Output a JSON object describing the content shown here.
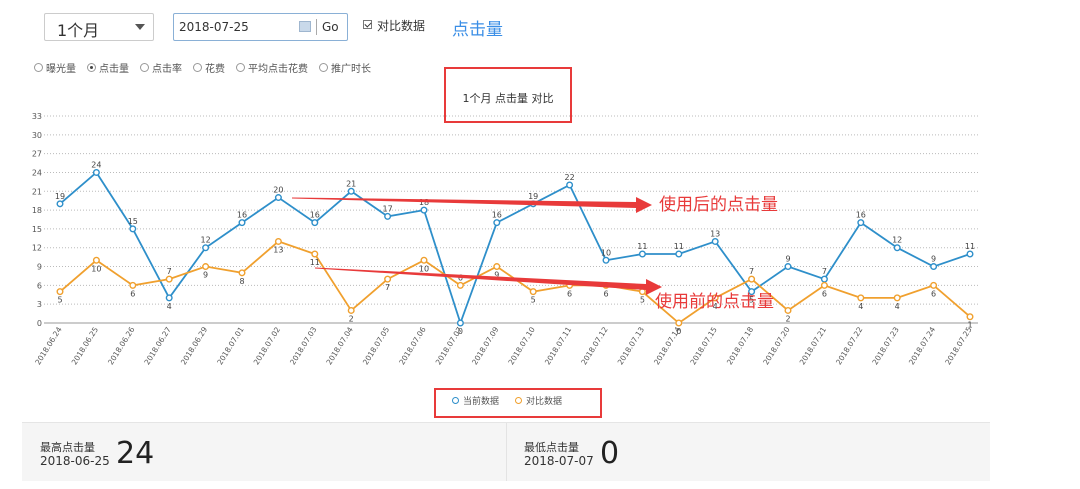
{
  "controls": {
    "period_value": "1个月",
    "date_value": "2018-07-25",
    "go_label": "Go",
    "compare_label": "对比数据",
    "compare_checked": true,
    "metric_title": "点击量"
  },
  "metric_options": [
    {
      "label": "曝光量",
      "selected": false
    },
    {
      "label": "点击量",
      "selected": true
    },
    {
      "label": "点击率",
      "selected": false
    },
    {
      "label": "花费",
      "selected": false
    },
    {
      "label": "平均点击花费",
      "selected": false
    },
    {
      "label": "推广时长",
      "selected": false
    }
  ],
  "chart_data": {
    "type": "line",
    "title": "1个月 点击量 对比",
    "x": [
      "2018.06.24",
      "2018.06.25",
      "2018.06.26",
      "2018.06.27",
      "2018.06.29",
      "2018.07.01",
      "2018.07.02",
      "2018.07.03",
      "2018.07.04",
      "2018.07.05",
      "2018.07.06",
      "2018.07.07",
      "2018.07.09",
      "2018.07.10",
      "2018.07.11",
      "2018.07.12",
      "2018.07.13",
      "2018.07.14",
      "2018.07.15",
      "2018.07.18",
      "2018.07.20",
      "2018.07.21",
      "2018.07.22",
      "2018.07.23",
      "2018.07.24",
      "2018.07.25"
    ],
    "yticks": [
      0,
      3,
      6,
      9,
      12,
      15,
      18,
      21,
      24,
      27,
      30,
      33
    ],
    "ylim": [
      0,
      33
    ],
    "grid": true,
    "legend_position": "bottom",
    "series": [
      {
        "name": "当前数据",
        "color": "#2e8fca",
        "values": [
          19,
          24,
          15,
          4,
          12,
          16,
          20,
          16,
          21,
          17,
          18,
          0,
          16,
          19,
          22,
          10,
          11,
          11,
          13,
          5,
          9,
          7,
          16,
          12,
          9,
          11
        ]
      },
      {
        "name": "对比数据",
        "color": "#f0a02e",
        "values": [
          5,
          10,
          6,
          7,
          9,
          8,
          13,
          11,
          2,
          7,
          10,
          6,
          9,
          5,
          6,
          6,
          5,
          0,
          4,
          7,
          2,
          6,
          4,
          4,
          6,
          1
        ]
      }
    ]
  },
  "annotations": {
    "after_label": "使用后的点击量",
    "before_label": "使用前的点击量",
    "color": "#e83a3a"
  },
  "stats": {
    "max_label": "最高点击量",
    "max_date": "2018-06-25",
    "max_value": "24",
    "min_label": "最低点击量",
    "min_date": "2018-07-07",
    "min_value": "0"
  }
}
